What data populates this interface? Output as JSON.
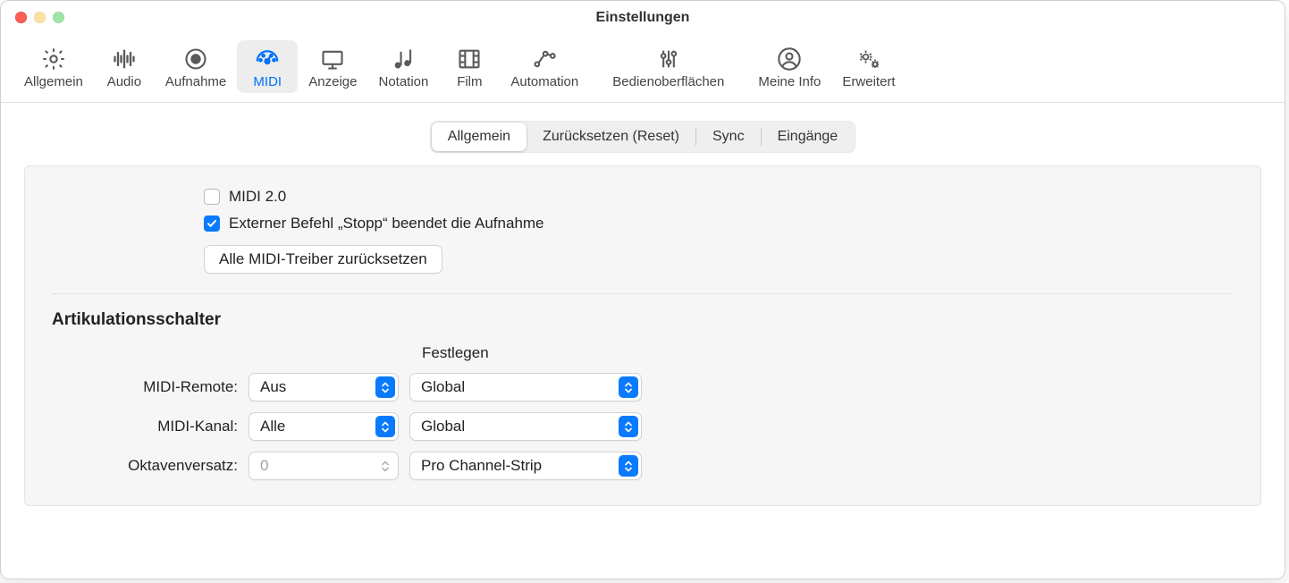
{
  "window": {
    "title": "Einstellungen"
  },
  "toolbar": {
    "items": [
      {
        "id": "general",
        "label": "Allgemein",
        "icon": "gear"
      },
      {
        "id": "audio",
        "label": "Audio",
        "icon": "waveform"
      },
      {
        "id": "record",
        "label": "Aufnahme",
        "icon": "record"
      },
      {
        "id": "midi",
        "label": "MIDI",
        "icon": "gauge",
        "active": true
      },
      {
        "id": "display",
        "label": "Anzeige",
        "icon": "display"
      },
      {
        "id": "notation",
        "label": "Notation",
        "icon": "notes"
      },
      {
        "id": "film",
        "label": "Film",
        "icon": "film"
      },
      {
        "id": "automation",
        "label": "Automation",
        "icon": "automation"
      },
      {
        "id": "surfaces",
        "label": "Bedienoberflächen",
        "icon": "sliders"
      },
      {
        "id": "myinfo",
        "label": "Meine Info",
        "icon": "person"
      },
      {
        "id": "advanced",
        "label": "Erweitert",
        "icon": "gears"
      }
    ]
  },
  "subtabs": {
    "items": [
      "Allgemein",
      "Zurücksetzen (Reset)",
      "Sync",
      "Eingänge"
    ],
    "selected": 0
  },
  "checks": {
    "midi20": {
      "label": "MIDI 2.0",
      "checked": false
    },
    "stopcmd": {
      "label": "Externer Befehl „Stopp“ beendet die Aufnahme",
      "checked": true
    }
  },
  "buttons": {
    "resetDrivers": "Alle MIDI-Treiber zurücksetzen"
  },
  "section": {
    "title": "Artikulationsschalter"
  },
  "columns": {
    "define": "Festlegen"
  },
  "rows": {
    "remote": {
      "label": "MIDI-Remote:",
      "value": "Aus",
      "define": "Global"
    },
    "channel": {
      "label": "MIDI-Kanal:",
      "value": "Alle",
      "define": "Global"
    },
    "octave": {
      "label": "Oktavenversatz:",
      "value": "0",
      "define": "Pro Channel-Strip",
      "disabled": true
    }
  }
}
